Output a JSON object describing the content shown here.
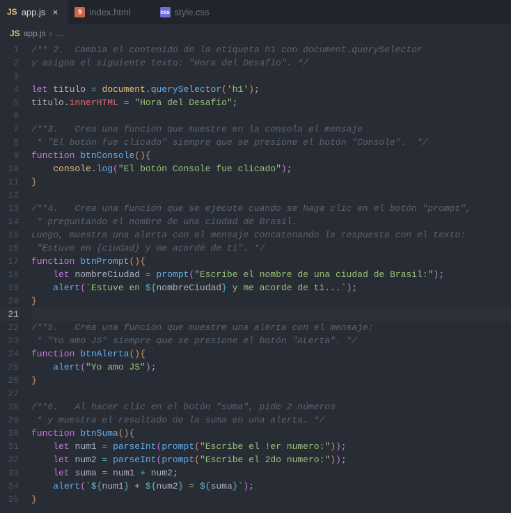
{
  "tabs": {
    "items": [
      {
        "icon": "JS",
        "label": "app.js",
        "active": true
      },
      {
        "icon": "5",
        "label": "index.html",
        "active": false
      },
      {
        "icon": "css",
        "label": "style.css",
        "active": false
      }
    ]
  },
  "breadcrumb": {
    "icon": "JS",
    "file": "app.js",
    "rest": "…"
  },
  "code": {
    "lines": [
      [
        {
          "t": "cm",
          "v": "/** 2.  Cambia el contenido de la etiqueta h1 con document.querySelector"
        }
      ],
      [
        {
          "t": "cm",
          "v": "y asigna el siguiente texto: \"Hora del Desafío\". */"
        }
      ],
      [],
      [
        {
          "t": "kw",
          "v": "let"
        },
        {
          "t": "pun",
          "v": " "
        },
        {
          "t": "idl",
          "v": "titulo"
        },
        {
          "t": "pun",
          "v": " "
        },
        {
          "t": "op",
          "v": "="
        },
        {
          "t": "pun",
          "v": " "
        },
        {
          "t": "obj",
          "v": "document"
        },
        {
          "t": "pun",
          "v": "."
        },
        {
          "t": "call",
          "v": "querySelector"
        },
        {
          "t": "brace",
          "v": "("
        },
        {
          "t": "str",
          "v": "'h1'"
        },
        {
          "t": "brace",
          "v": ")"
        },
        {
          "t": "pun",
          "v": ";"
        }
      ],
      [
        {
          "t": "idl",
          "v": "titulo"
        },
        {
          "t": "pun",
          "v": "."
        },
        {
          "t": "prop",
          "v": "innerHTML"
        },
        {
          "t": "pun",
          "v": " "
        },
        {
          "t": "op",
          "v": "="
        },
        {
          "t": "pun",
          "v": " "
        },
        {
          "t": "str",
          "v": "\"Hora del Desafío\""
        },
        {
          "t": "pun",
          "v": ";"
        }
      ],
      [],
      [
        {
          "t": "cm",
          "v": "/**3.   Crea una función que muestre en la consola el mensaje"
        }
      ],
      [
        {
          "t": "cm",
          "v": " * \"El botón fue clicado\" siempre que se presione el botón \"Console\".  */"
        }
      ],
      [
        {
          "t": "kw",
          "v": "function"
        },
        {
          "t": "pun",
          "v": " "
        },
        {
          "t": "fn",
          "v": "btnConsole"
        },
        {
          "t": "brace",
          "v": "()"
        },
        {
          "t": "brace",
          "v": "{"
        }
      ],
      [
        {
          "t": "pun",
          "v": "    "
        },
        {
          "t": "obj",
          "v": "console"
        },
        {
          "t": "pun",
          "v": "."
        },
        {
          "t": "call",
          "v": "log"
        },
        {
          "t": "brace2",
          "v": "("
        },
        {
          "t": "str",
          "v": "\"El botón Console fue clicado\""
        },
        {
          "t": "brace2",
          "v": ")"
        },
        {
          "t": "pun",
          "v": ";"
        }
      ],
      [
        {
          "t": "brace",
          "v": "}"
        }
      ],
      [],
      [
        {
          "t": "cm",
          "v": "/**4.   Crea una función que se ejecute cuando se haga clic en el botón \"prompt\","
        }
      ],
      [
        {
          "t": "cm",
          "v": " * preguntando el nombre de una ciudad de Brasil."
        }
      ],
      [
        {
          "t": "cm",
          "v": "Luego, muestra una alerta con el mensaje concatenando la respuesta con el texto:"
        }
      ],
      [
        {
          "t": "cm",
          "v": " \"Estuve en {ciudad} y me acordé de ti\". */"
        }
      ],
      [
        {
          "t": "kw",
          "v": "function"
        },
        {
          "t": "pun",
          "v": " "
        },
        {
          "t": "fn",
          "v": "btnPrompt"
        },
        {
          "t": "brace",
          "v": "()"
        },
        {
          "t": "brace",
          "v": "{"
        }
      ],
      [
        {
          "t": "pun",
          "v": "    "
        },
        {
          "t": "kw",
          "v": "let"
        },
        {
          "t": "pun",
          "v": " "
        },
        {
          "t": "idl",
          "v": "nombreCiudad"
        },
        {
          "t": "pun",
          "v": " "
        },
        {
          "t": "op",
          "v": "="
        },
        {
          "t": "pun",
          "v": " "
        },
        {
          "t": "call",
          "v": "prompt"
        },
        {
          "t": "brace2",
          "v": "("
        },
        {
          "t": "str",
          "v": "\"Escribe el nombre de una ciudad de Brasil:\""
        },
        {
          "t": "brace2",
          "v": ")"
        },
        {
          "t": "pun",
          "v": ";"
        }
      ],
      [
        {
          "t": "pun",
          "v": "    "
        },
        {
          "t": "call",
          "v": "alert"
        },
        {
          "t": "brace2",
          "v": "("
        },
        {
          "t": "str",
          "v": "`Estuve en "
        },
        {
          "t": "tpl",
          "v": "${"
        },
        {
          "t": "idl",
          "v": "nombreCiudad"
        },
        {
          "t": "tpl",
          "v": "}"
        },
        {
          "t": "str",
          "v": " y me acorde de ti...`"
        },
        {
          "t": "brace2",
          "v": ")"
        },
        {
          "t": "pun",
          "v": ";"
        }
      ],
      [
        {
          "t": "brace",
          "v": "}"
        }
      ],
      [],
      [
        {
          "t": "cm",
          "v": "/**5.   Crea una función que muestre una alerta con el mensaje:"
        }
      ],
      [
        {
          "t": "cm",
          "v": " * \"Yo amo JS\" siempre que se presione el botón \"ALerta\". */"
        }
      ],
      [
        {
          "t": "kw",
          "v": "function"
        },
        {
          "t": "pun",
          "v": " "
        },
        {
          "t": "fn",
          "v": "btnAlerta"
        },
        {
          "t": "brace",
          "v": "()"
        },
        {
          "t": "brace",
          "v": "{"
        }
      ],
      [
        {
          "t": "pun",
          "v": "    "
        },
        {
          "t": "call",
          "v": "alert"
        },
        {
          "t": "brace2",
          "v": "("
        },
        {
          "t": "str",
          "v": "\"Yo amo JS\""
        },
        {
          "t": "brace2",
          "v": ")"
        },
        {
          "t": "pun",
          "v": ";"
        }
      ],
      [
        {
          "t": "brace",
          "v": "}"
        }
      ],
      [],
      [
        {
          "t": "cm",
          "v": "/**6.   Al hacer clic en el botón \"suma\", pide 2 números"
        }
      ],
      [
        {
          "t": "cm",
          "v": " * y muestra el resultado de la suma en una alerta. */"
        }
      ],
      [
        {
          "t": "kw",
          "v": "function"
        },
        {
          "t": "pun",
          "v": " "
        },
        {
          "t": "fn",
          "v": "btnSuma"
        },
        {
          "t": "brace",
          "v": "()"
        },
        {
          "t": "brace",
          "v": "{"
        }
      ],
      [
        {
          "t": "pun",
          "v": "    "
        },
        {
          "t": "kw",
          "v": "let"
        },
        {
          "t": "pun",
          "v": " "
        },
        {
          "t": "idl",
          "v": "num1"
        },
        {
          "t": "pun",
          "v": " "
        },
        {
          "t": "op",
          "v": "="
        },
        {
          "t": "pun",
          "v": " "
        },
        {
          "t": "call",
          "v": "parseInt"
        },
        {
          "t": "brace2",
          "v": "("
        },
        {
          "t": "call",
          "v": "prompt"
        },
        {
          "t": "brace",
          "v": "("
        },
        {
          "t": "str",
          "v": "\"Escribe el !er numero:\""
        },
        {
          "t": "brace",
          "v": ")"
        },
        {
          "t": "brace2",
          "v": ")"
        },
        {
          "t": "pun",
          "v": ";"
        }
      ],
      [
        {
          "t": "pun",
          "v": "    "
        },
        {
          "t": "kw",
          "v": "let"
        },
        {
          "t": "pun",
          "v": " "
        },
        {
          "t": "idl",
          "v": "num2"
        },
        {
          "t": "pun",
          "v": " "
        },
        {
          "t": "op",
          "v": "="
        },
        {
          "t": "pun",
          "v": " "
        },
        {
          "t": "call",
          "v": "parseInt"
        },
        {
          "t": "brace2",
          "v": "("
        },
        {
          "t": "call",
          "v": "prompt"
        },
        {
          "t": "brace",
          "v": "("
        },
        {
          "t": "str",
          "v": "\"Escribe el 2do numero:\""
        },
        {
          "t": "brace",
          "v": ")"
        },
        {
          "t": "brace2",
          "v": ")"
        },
        {
          "t": "pun",
          "v": ";"
        }
      ],
      [
        {
          "t": "pun",
          "v": "    "
        },
        {
          "t": "kw",
          "v": "let"
        },
        {
          "t": "pun",
          "v": " "
        },
        {
          "t": "idl",
          "v": "suma"
        },
        {
          "t": "pun",
          "v": " "
        },
        {
          "t": "op",
          "v": "="
        },
        {
          "t": "pun",
          "v": " "
        },
        {
          "t": "idl",
          "v": "num1"
        },
        {
          "t": "pun",
          "v": " "
        },
        {
          "t": "op",
          "v": "+"
        },
        {
          "t": "pun",
          "v": " "
        },
        {
          "t": "idl",
          "v": "num2"
        },
        {
          "t": "pun",
          "v": ";"
        }
      ],
      [
        {
          "t": "pun",
          "v": "    "
        },
        {
          "t": "call",
          "v": "alert"
        },
        {
          "t": "brace2",
          "v": "("
        },
        {
          "t": "str",
          "v": "`"
        },
        {
          "t": "tpl",
          "v": "${"
        },
        {
          "t": "idl",
          "v": "num1"
        },
        {
          "t": "tpl",
          "v": "}"
        },
        {
          "t": "str",
          "v": " + "
        },
        {
          "t": "tpl",
          "v": "${"
        },
        {
          "t": "idl",
          "v": "num2"
        },
        {
          "t": "tpl",
          "v": "}"
        },
        {
          "t": "str",
          "v": " = "
        },
        {
          "t": "tpl",
          "v": "${"
        },
        {
          "t": "idl",
          "v": "suma"
        },
        {
          "t": "tpl",
          "v": "}"
        },
        {
          "t": "str",
          "v": "`"
        },
        {
          "t": "brace2",
          "v": ")"
        },
        {
          "t": "pun",
          "v": ";"
        }
      ],
      [
        {
          "t": "brace",
          "v": "}"
        }
      ]
    ],
    "activeLine": 21
  }
}
